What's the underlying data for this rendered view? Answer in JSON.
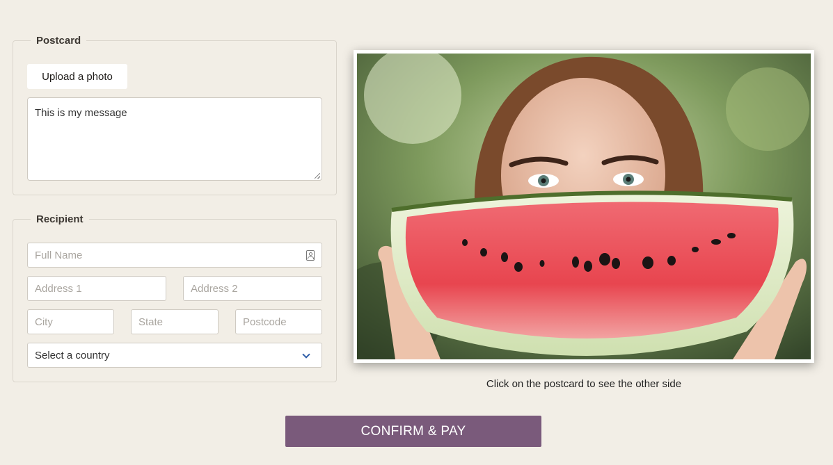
{
  "postcard": {
    "legend": "Postcard",
    "upload_label": "Upload a photo",
    "message": "This is my message"
  },
  "recipient": {
    "legend": "Recipient",
    "full_name_placeholder": "Full Name",
    "address1_placeholder": "Address 1",
    "address2_placeholder": "Address 2",
    "city_placeholder": "City",
    "state_placeholder": "State",
    "postcode_placeholder": "Postcode",
    "country_selected": "Select a country"
  },
  "preview": {
    "hint": "Click on the postcard to see the other side"
  },
  "actions": {
    "confirm_label": "CONFIRM & PAY"
  },
  "icons": {
    "contact": "contact-card-icon",
    "dropdown": "chevron-down-icon"
  },
  "colors": {
    "background": "#f2eee6",
    "accent_button": "#7a5a7b",
    "chevron": "#2f5ea8"
  }
}
